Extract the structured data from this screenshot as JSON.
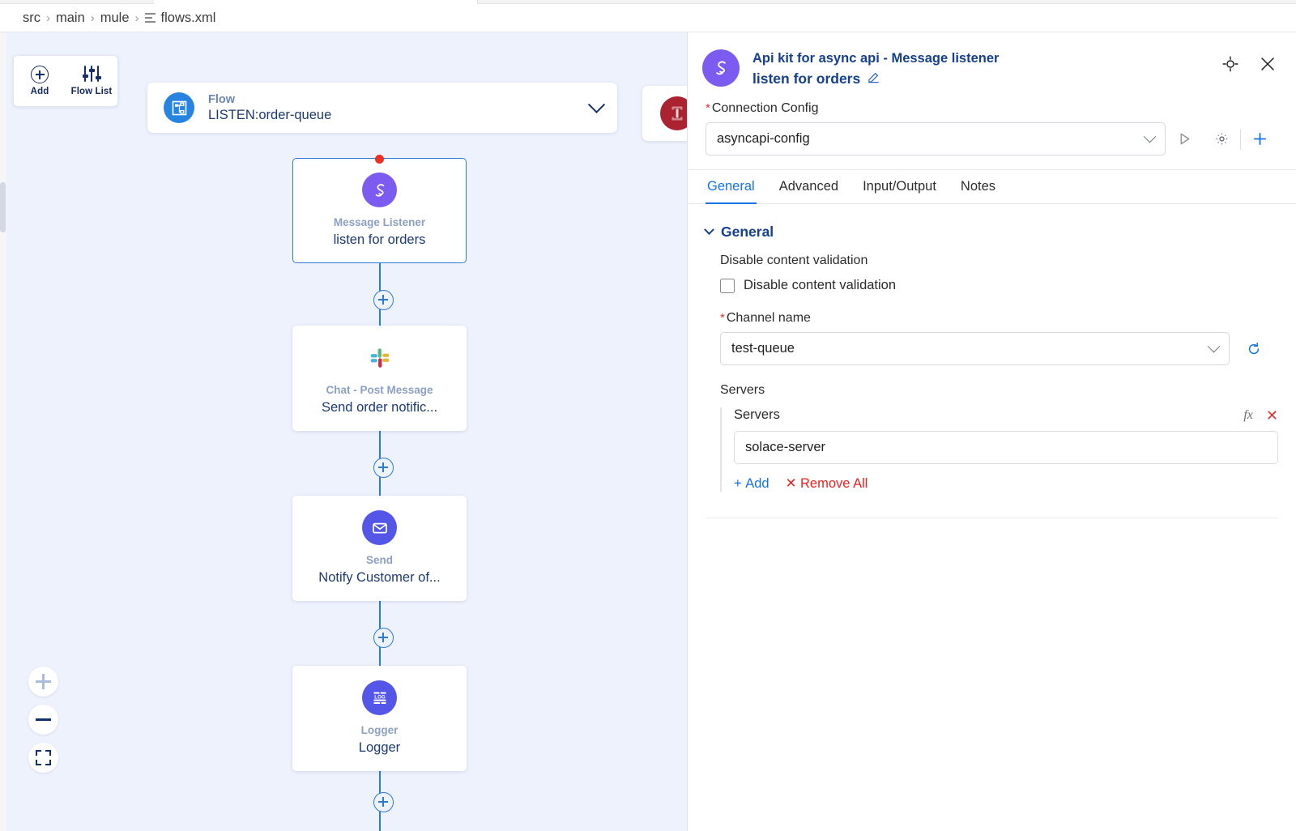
{
  "breadcrumb": {
    "items": [
      "src",
      "main",
      "mule"
    ],
    "separator": "›",
    "file": "flows.xml"
  },
  "canvas_toolbar": {
    "add_label": "Add",
    "flow_list_label": "Flow List"
  },
  "flow_header": {
    "kind": "Flow",
    "name": "LISTEN:order-queue"
  },
  "flow_nodes": [
    {
      "type": "Message Listener",
      "name": "listen for orders",
      "icon": "solace-icon",
      "selected": true,
      "has_error_dot": true
    },
    {
      "type": "Chat - Post Message",
      "name": "Send order notific...",
      "icon": "slack-icon",
      "selected": false,
      "has_error_dot": false
    },
    {
      "type": "Send",
      "name": "Notify Customer of...",
      "icon": "email-icon",
      "selected": false,
      "has_error_dot": false
    },
    {
      "type": "Logger",
      "name": "Logger",
      "icon": "logger-icon",
      "selected": false,
      "has_error_dot": false
    }
  ],
  "panel": {
    "header": {
      "subtitle": "Api kit for async api - Message listener",
      "title": "listen for orders"
    },
    "connection_config": {
      "label": "Connection Config",
      "required": true,
      "value": "asyncapi-config"
    },
    "tabs": [
      {
        "label": "General",
        "active": true
      },
      {
        "label": "Advanced",
        "active": false
      },
      {
        "label": "Input/Output",
        "active": false
      },
      {
        "label": "Notes",
        "active": false
      }
    ],
    "general_section": {
      "title": "General",
      "disable_validation_label": "Disable content validation",
      "disable_validation_checkbox_label": "Disable content validation",
      "disable_validation_checked": false,
      "channel_name_label": "Channel name",
      "channel_name_required": true,
      "channel_name_value": "test-queue",
      "servers_label": "Servers",
      "servers_inner_label": "Servers",
      "servers_value": "solace-server",
      "add_label": "Add",
      "remove_all_label": "Remove All"
    }
  },
  "colors": {
    "canvas_bg": "#eef2fd",
    "accent_blue": "#1473e6",
    "node_border": "#2b7bd4",
    "title_navy": "#14408f",
    "solace_purple": "#7c5cf0",
    "error_red": "#ec2f22",
    "error_handler_red": "#ab2230",
    "remove_red": "#f02020"
  }
}
